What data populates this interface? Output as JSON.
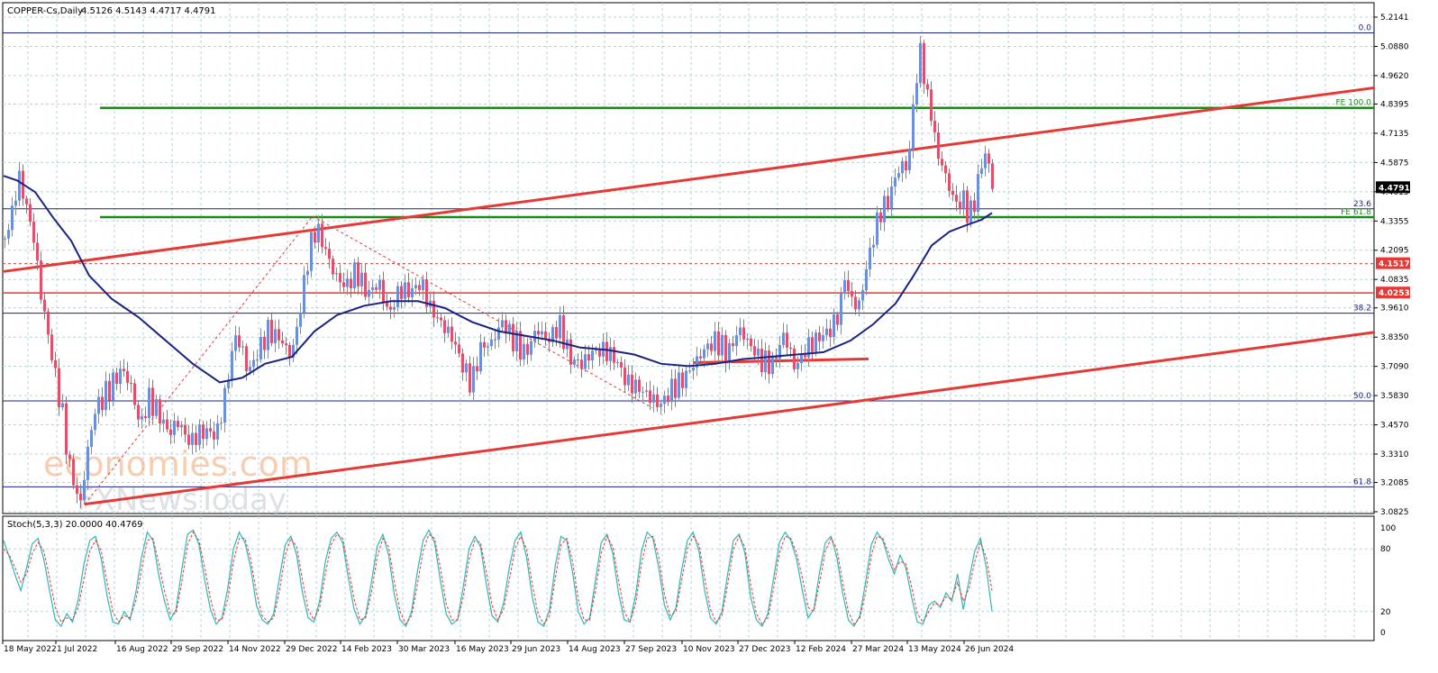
{
  "chart_data": [
    {
      "type": "candlestick",
      "instrument_label": "COPPER-Cs,Daily",
      "ohlc_label": "4.5126 4.5143 4.4717 4.4791",
      "last_price_label": "4.4791",
      "y_axis_ticks": [
        "5.2141",
        "5.0880",
        "4.9620",
        "4.8395",
        "4.7135",
        "4.5875",
        "4.4615",
        "4.3355",
        "4.2095",
        "4.0835",
        "3.9610",
        "3.8350",
        "3.7090",
        "3.5830",
        "3.4570",
        "3.3310",
        "3.2085",
        "3.0825"
      ],
      "x_axis_ticks": [
        "18 May 2022",
        "1 Jul 2022",
        "16 Aug 2022",
        "29 Sep 2022",
        "14 Nov 2022",
        "29 Dec 2022",
        "14 Feb 2023",
        "30 Mar 2023",
        "16 May 2023",
        "29 Jun 2023",
        "14 Aug 2023",
        "27 Sep 2023",
        "10 Nov 2023",
        "27 Dec 2023",
        "12 Feb 2024",
        "27 Mar 2024",
        "13 May 2024",
        "26 Jun 2024"
      ],
      "ylim": [
        3.0825,
        5.2141
      ],
      "close_path": [
        {
          "t": 0,
          "v": 4.26
        },
        {
          "t": 8,
          "v": 4.37
        },
        {
          "t": 15,
          "v": 4.53
        },
        {
          "t": 22,
          "v": 4.43
        },
        {
          "t": 32,
          "v": 4.26
        },
        {
          "t": 40,
          "v": 4.02
        },
        {
          "t": 50,
          "v": 3.8
        },
        {
          "t": 58,
          "v": 3.62
        },
        {
          "t": 64,
          "v": 3.5
        },
        {
          "t": 70,
          "v": 3.31
        },
        {
          "t": 78,
          "v": 3.18
        },
        {
          "t": 84,
          "v": 3.12
        },
        {
          "t": 92,
          "v": 3.35
        },
        {
          "t": 100,
          "v": 3.52
        },
        {
          "t": 110,
          "v": 3.58
        },
        {
          "t": 122,
          "v": 3.65
        },
        {
          "t": 130,
          "v": 3.7
        },
        {
          "t": 140,
          "v": 3.62
        },
        {
          "t": 150,
          "v": 3.45
        },
        {
          "t": 160,
          "v": 3.57
        },
        {
          "t": 170,
          "v": 3.51
        },
        {
          "t": 182,
          "v": 3.42
        },
        {
          "t": 192,
          "v": 3.47
        },
        {
          "t": 205,
          "v": 3.38
        },
        {
          "t": 215,
          "v": 3.42
        },
        {
          "t": 225,
          "v": 3.43
        },
        {
          "t": 235,
          "v": 3.41
        },
        {
          "t": 245,
          "v": 3.6
        },
        {
          "t": 255,
          "v": 3.84
        },
        {
          "t": 262,
          "v": 3.8
        },
        {
          "t": 270,
          "v": 3.68
        },
        {
          "t": 282,
          "v": 3.78
        },
        {
          "t": 292,
          "v": 3.86
        },
        {
          "t": 305,
          "v": 3.83
        },
        {
          "t": 318,
          "v": 3.75
        },
        {
          "t": 328,
          "v": 3.96
        },
        {
          "t": 336,
          "v": 4.17
        },
        {
          "t": 345,
          "v": 4.31
        },
        {
          "t": 355,
          "v": 4.22
        },
        {
          "t": 365,
          "v": 4.11
        },
        {
          "t": 378,
          "v": 4.05
        },
        {
          "t": 390,
          "v": 4.12
        },
        {
          "t": 402,
          "v": 4.02
        },
        {
          "t": 415,
          "v": 4.07
        },
        {
          "t": 426,
          "v": 3.93
        },
        {
          "t": 438,
          "v": 4.04
        },
        {
          "t": 450,
          "v": 4.03
        },
        {
          "t": 462,
          "v": 4.07
        },
        {
          "t": 472,
          "v": 3.96
        },
        {
          "t": 485,
          "v": 3.89
        },
        {
          "t": 497,
          "v": 3.83
        },
        {
          "t": 507,
          "v": 3.72
        },
        {
          "t": 518,
          "v": 3.63
        },
        {
          "t": 528,
          "v": 3.79
        },
        {
          "t": 540,
          "v": 3.81
        },
        {
          "t": 552,
          "v": 3.9
        },
        {
          "t": 565,
          "v": 3.82
        },
        {
          "t": 578,
          "v": 3.76
        },
        {
          "t": 590,
          "v": 3.87
        },
        {
          "t": 603,
          "v": 3.82
        },
        {
          "t": 615,
          "v": 3.89
        },
        {
          "t": 628,
          "v": 3.74
        },
        {
          "t": 640,
          "v": 3.72
        },
        {
          "t": 652,
          "v": 3.77
        },
        {
          "t": 665,
          "v": 3.78
        },
        {
          "t": 678,
          "v": 3.74
        },
        {
          "t": 690,
          "v": 3.64
        },
        {
          "t": 702,
          "v": 3.62
        },
        {
          "t": 715,
          "v": 3.58
        },
        {
          "t": 727,
          "v": 3.54
        },
        {
          "t": 740,
          "v": 3.61
        },
        {
          "t": 752,
          "v": 3.65
        },
        {
          "t": 765,
          "v": 3.72
        },
        {
          "t": 778,
          "v": 3.79
        },
        {
          "t": 790,
          "v": 3.82
        },
        {
          "t": 802,
          "v": 3.76
        },
        {
          "t": 815,
          "v": 3.87
        },
        {
          "t": 827,
          "v": 3.8
        },
        {
          "t": 840,
          "v": 3.73
        },
        {
          "t": 852,
          "v": 3.72
        },
        {
          "t": 865,
          "v": 3.85
        },
        {
          "t": 877,
          "v": 3.7
        },
        {
          "t": 890,
          "v": 3.79
        },
        {
          "t": 902,
          "v": 3.83
        },
        {
          "t": 915,
          "v": 3.86
        },
        {
          "t": 925,
          "v": 3.93
        },
        {
          "t": 932,
          "v": 4.09
        },
        {
          "t": 940,
          "v": 3.99
        },
        {
          "t": 948,
          "v": 3.97
        },
        {
          "t": 956,
          "v": 4.13
        },
        {
          "t": 964,
          "v": 4.27
        },
        {
          "t": 972,
          "v": 4.38
        },
        {
          "t": 980,
          "v": 4.42
        },
        {
          "t": 988,
          "v": 4.52
        },
        {
          "t": 995,
          "v": 4.58
        },
        {
          "t": 1002,
          "v": 4.56
        },
        {
          "t": 1008,
          "v": 4.82
        },
        {
          "t": 1013,
          "v": 5.0
        },
        {
          "t": 1018,
          "v": 5.09
        },
        {
          "t": 1022,
          "v": 4.87
        },
        {
          "t": 1028,
          "v": 4.81
        },
        {
          "t": 1034,
          "v": 4.63
        },
        {
          "t": 1040,
          "v": 4.58
        },
        {
          "t": 1046,
          "v": 4.5
        },
        {
          "t": 1052,
          "v": 4.44
        },
        {
          "t": 1058,
          "v": 4.4
        },
        {
          "t": 1064,
          "v": 4.43
        },
        {
          "t": 1070,
          "v": 4.35
        },
        {
          "t": 1076,
          "v": 4.42
        },
        {
          "t": 1082,
          "v": 4.55
        },
        {
          "t": 1088,
          "v": 4.63
        },
        {
          "t": 1093,
          "v": 4.55
        },
        {
          "t": 1097,
          "v": 4.48
        }
      ],
      "moving_average": [
        {
          "t": 0,
          "v": 4.53
        },
        {
          "t": 15,
          "v": 4.51
        },
        {
          "t": 35,
          "v": 4.46
        },
        {
          "t": 55,
          "v": 4.35
        },
        {
          "t": 75,
          "v": 4.25
        },
        {
          "t": 95,
          "v": 4.1
        },
        {
          "t": 120,
          "v": 4.0
        },
        {
          "t": 150,
          "v": 3.92
        },
        {
          "t": 180,
          "v": 3.82
        },
        {
          "t": 210,
          "v": 3.72
        },
        {
          "t": 240,
          "v": 3.64
        },
        {
          "t": 265,
          "v": 3.66
        },
        {
          "t": 290,
          "v": 3.72
        },
        {
          "t": 320,
          "v": 3.75
        },
        {
          "t": 345,
          "v": 3.86
        },
        {
          "t": 370,
          "v": 3.93
        },
        {
          "t": 400,
          "v": 3.97
        },
        {
          "t": 430,
          "v": 3.99
        },
        {
          "t": 460,
          "v": 3.99
        },
        {
          "t": 490,
          "v": 3.96
        },
        {
          "t": 520,
          "v": 3.9
        },
        {
          "t": 550,
          "v": 3.86
        },
        {
          "t": 580,
          "v": 3.84
        },
        {
          "t": 610,
          "v": 3.82
        },
        {
          "t": 640,
          "v": 3.79
        },
        {
          "t": 670,
          "v": 3.78
        },
        {
          "t": 700,
          "v": 3.76
        },
        {
          "t": 730,
          "v": 3.72
        },
        {
          "t": 760,
          "v": 3.71
        },
        {
          "t": 790,
          "v": 3.72
        },
        {
          "t": 820,
          "v": 3.74
        },
        {
          "t": 850,
          "v": 3.75
        },
        {
          "t": 880,
          "v": 3.76
        },
        {
          "t": 910,
          "v": 3.77
        },
        {
          "t": 940,
          "v": 3.82
        },
        {
          "t": 965,
          "v": 3.89
        },
        {
          "t": 990,
          "v": 3.98
        },
        {
          "t": 1010,
          "v": 4.1
        },
        {
          "t": 1030,
          "v": 4.23
        },
        {
          "t": 1050,
          "v": 4.29
        },
        {
          "t": 1070,
          "v": 4.32
        },
        {
          "t": 1085,
          "v": 4.34
        },
        {
          "t": 1097,
          "v": 4.37
        }
      ],
      "horizontal_levels": [
        {
          "label": "0.0",
          "value": 5.146,
          "color": "#1a237e",
          "style": "solid"
        },
        {
          "label": "FE 100.0",
          "value": 4.823,
          "color": "#1b8a1b",
          "style": "solid",
          "from_t": 107
        },
        {
          "label": "23.6",
          "value": 4.388,
          "color": "#1a237e",
          "style": "solid"
        },
        {
          "label": "FE 61.8",
          "value": 4.352,
          "color": "#1b8a1b",
          "style": "solid",
          "from_t": 107
        },
        {
          "label": "38.2",
          "value": 3.938,
          "color": "#1a237e",
          "style": "solid"
        },
        {
          "label": "50.0",
          "value": 3.56,
          "color": "#1a237e",
          "style": "solid"
        },
        {
          "label": "61.8",
          "value": 3.19,
          "color": "#1a237e",
          "style": "solid"
        }
      ],
      "price_tags": [
        {
          "label": "4.1517",
          "value": 4.1517,
          "color": "#e53935",
          "style": "dashed"
        },
        {
          "label": "4.0253",
          "value": 4.0253,
          "color": "#e53935",
          "style": "solid"
        }
      ],
      "trend_lines": [
        {
          "name": "upper-channel",
          "t0": 0,
          "v0": 4.118,
          "t1": 1522,
          "v1": 4.91,
          "color": "#e53935"
        },
        {
          "name": "lower-channel",
          "t0": 90,
          "v0": 3.115,
          "t1": 1522,
          "v1": 3.856,
          "color": "#e53935"
        },
        {
          "name": "support-segment",
          "t0": 765,
          "v0": 3.725,
          "t1": 960,
          "v1": 3.741,
          "color": "#e53935"
        }
      ],
      "fib_connectors": [
        {
          "t0": 90,
          "v0": 3.115,
          "t1": 343,
          "v1": 4.356
        },
        {
          "t0": 343,
          "v0": 4.356,
          "t1": 720,
          "v1": 3.53
        }
      ],
      "watermark": {
        "line1": "economies.com",
        "line2": "FXNewsToday"
      }
    },
    {
      "type": "line",
      "indicator_label": "Stoch(5,3,3) 20.0000 40.4769",
      "ylim": [
        0,
        100
      ],
      "y_axis_ticks": [
        "100",
        "80",
        "20",
        "0"
      ],
      "levels": [
        80,
        20
      ],
      "series": [
        {
          "values": [
            88,
            72,
            55,
            40,
            62,
            85,
            90,
            70,
            40,
            12,
            6,
            18,
            10,
            32,
            66,
            88,
            92,
            70,
            35,
            10,
            8,
            20,
            12,
            38,
            72,
            96,
            88,
            55,
            30,
            12,
            22,
            60,
            94,
            98,
            84,
            50,
            22,
            8,
            14,
            42,
            80,
            96,
            86,
            62,
            26,
            12,
            8,
            18,
            52,
            84,
            92,
            74,
            38,
            14,
            10,
            30,
            68,
            90,
            96,
            86,
            52,
            22,
            8,
            16,
            48,
            82,
            94,
            74,
            36,
            12,
            6,
            20,
            58,
            88,
            98,
            86,
            50,
            18,
            8,
            12,
            44,
            80,
            92,
            82,
            46,
            16,
            10,
            28,
            62,
            88,
            96,
            72,
            34,
            10,
            6,
            22,
            64,
            92,
            88,
            58,
            20,
            8,
            14,
            50,
            86,
            94,
            76,
            38,
            12,
            10,
            36,
            78,
            96,
            90,
            62,
            26,
            12,
            24,
            60,
            88,
            96,
            78,
            40,
            14,
            8,
            20,
            56,
            88,
            94,
            76,
            34,
            12,
            6,
            18,
            52,
            86,
            96,
            88,
            70,
            40,
            14,
            22,
            58,
            86,
            92,
            72,
            38,
            12,
            6,
            16,
            48,
            84,
            96,
            88,
            70,
            56,
            74,
            62,
            34,
            10,
            8,
            26,
            30,
            24,
            38,
            30,
            56,
            22,
            50,
            78,
            90,
            62,
            20
          ]
        },
        {
          "values": [
            80,
            74,
            62,
            48,
            56,
            76,
            86,
            78,
            52,
            24,
            10,
            14,
            12,
            24,
            52,
            78,
            88,
            78,
            48,
            20,
            10,
            16,
            14,
            30,
            60,
            88,
            90,
            66,
            40,
            18,
            18,
            48,
            84,
            96,
            88,
            62,
            32,
            12,
            12,
            32,
            68,
            90,
            90,
            70,
            38,
            16,
            10,
            14,
            40,
            74,
            90,
            82,
            50,
            22,
            12,
            24,
            56,
            84,
            94,
            90,
            62,
            32,
            12,
            14,
            38,
            72,
            90,
            82,
            48,
            20,
            8,
            16,
            46,
            78,
            94,
            90,
            62,
            28,
            12,
            12,
            34,
            70,
            88,
            86,
            58,
            26,
            12,
            22,
            50,
            80,
            92,
            80,
            46,
            18,
            8,
            16,
            52,
            84,
            90,
            68,
            32,
            12,
            12,
            40,
            76,
            92,
            82,
            50,
            20,
            10,
            28,
            66,
            90,
            92,
            72,
            36,
            16,
            20,
            50,
            80,
            92,
            84,
            52,
            22,
            10,
            16,
            46,
            80,
            92,
            82,
            46,
            18,
            8,
            14,
            42,
            76,
            92,
            90,
            76,
            52,
            24,
            20,
            48,
            78,
            90,
            80,
            48,
            20,
            8,
            14,
            38,
            74,
            92,
            90,
            76,
            60,
            68,
            66,
            44,
            18,
            10,
            20,
            28,
            26,
            34,
            32,
            48,
            30,
            42,
            68,
            86,
            72,
            40
          ]
        }
      ]
    }
  ]
}
